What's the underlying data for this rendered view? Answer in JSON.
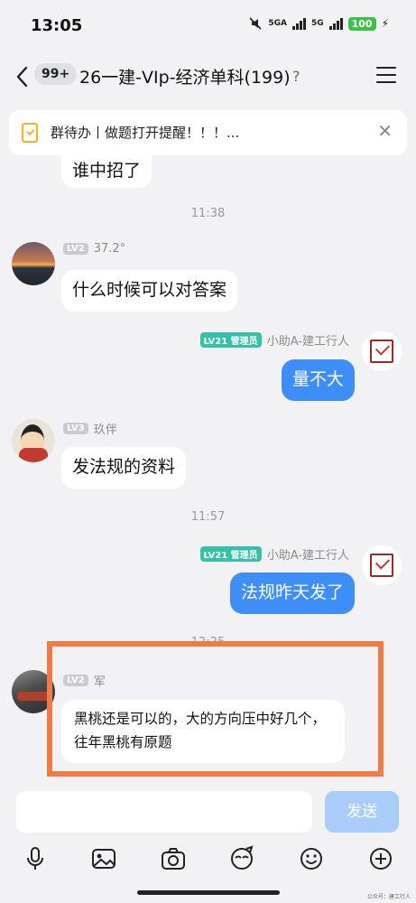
{
  "status": {
    "time": "13:05",
    "net1": "5GA",
    "net2": "5G",
    "battery": "100",
    "bolt": "⚡"
  },
  "header": {
    "unread_count": "99+",
    "title": "26一建-VIp-经济单科(199)",
    "ear_glyph": "?"
  },
  "todo_banner": {
    "text": "群待办丨做题打开提醒！！！...",
    "close": "✕"
  },
  "messages": {
    "m0": {
      "text": "谁中招了"
    },
    "t1": "11:38",
    "m1": {
      "level": "LV2",
      "sender": "37.2°",
      "text": "什么时候可以对答案"
    },
    "m2": {
      "level": "LV21 管理员",
      "sender": "小助A-建工行人",
      "text": "量不大"
    },
    "m3": {
      "level": "LV3",
      "sender": "玖伴",
      "text": "发法规的资料"
    },
    "t2": "11:57",
    "m4": {
      "level": "LV21 管理员",
      "sender": "小助A-建工行人",
      "text": "法规昨天发了"
    },
    "t3": "12:25",
    "m5": {
      "level": "LV2",
      "sender": "军",
      "text": "黑桃还是可以的，大的方向压中好几个，往年黑桃有原题"
    }
  },
  "composer": {
    "placeholder": "",
    "send_label": "发送"
  },
  "toolbar_icons": [
    "microphone-icon",
    "image-icon",
    "camera-icon",
    "sticker-icon",
    "emoji-icon",
    "plus-icon"
  ],
  "watermark": "公众号：建工行人",
  "colors": {
    "accent": "#3d8ef6",
    "admin_badge": "#37c0a8",
    "highlight": "#ef7b49"
  }
}
